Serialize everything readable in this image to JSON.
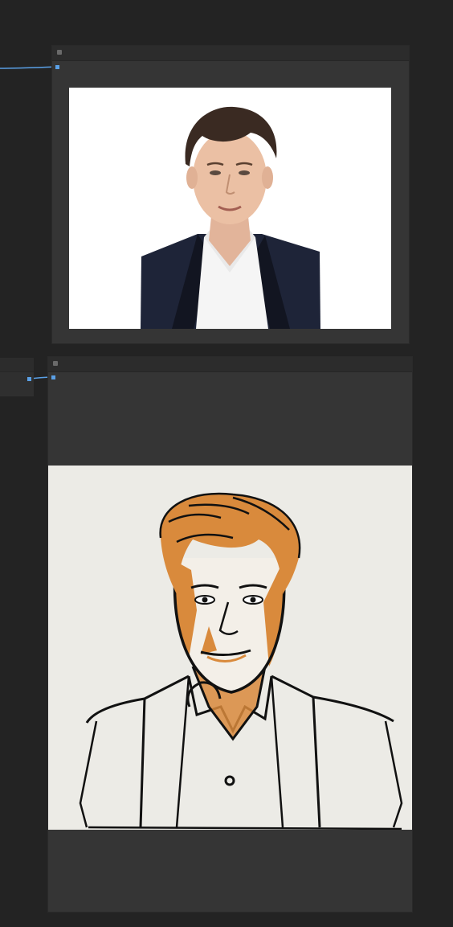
{
  "canvas": {
    "background": "#232323"
  },
  "nodes": [
    {
      "id": "photo-node",
      "title": "",
      "content": "portrait-photo-image"
    },
    {
      "id": "sketch-node",
      "title": "",
      "content": "portrait-sketch-image"
    }
  ],
  "colors": {
    "node_body": "#353535",
    "node_header": "#2c2c2c",
    "wire": "#5aa0e6",
    "sketch_accent": "#d98a3c",
    "sketch_paper": "#ecebe6"
  }
}
